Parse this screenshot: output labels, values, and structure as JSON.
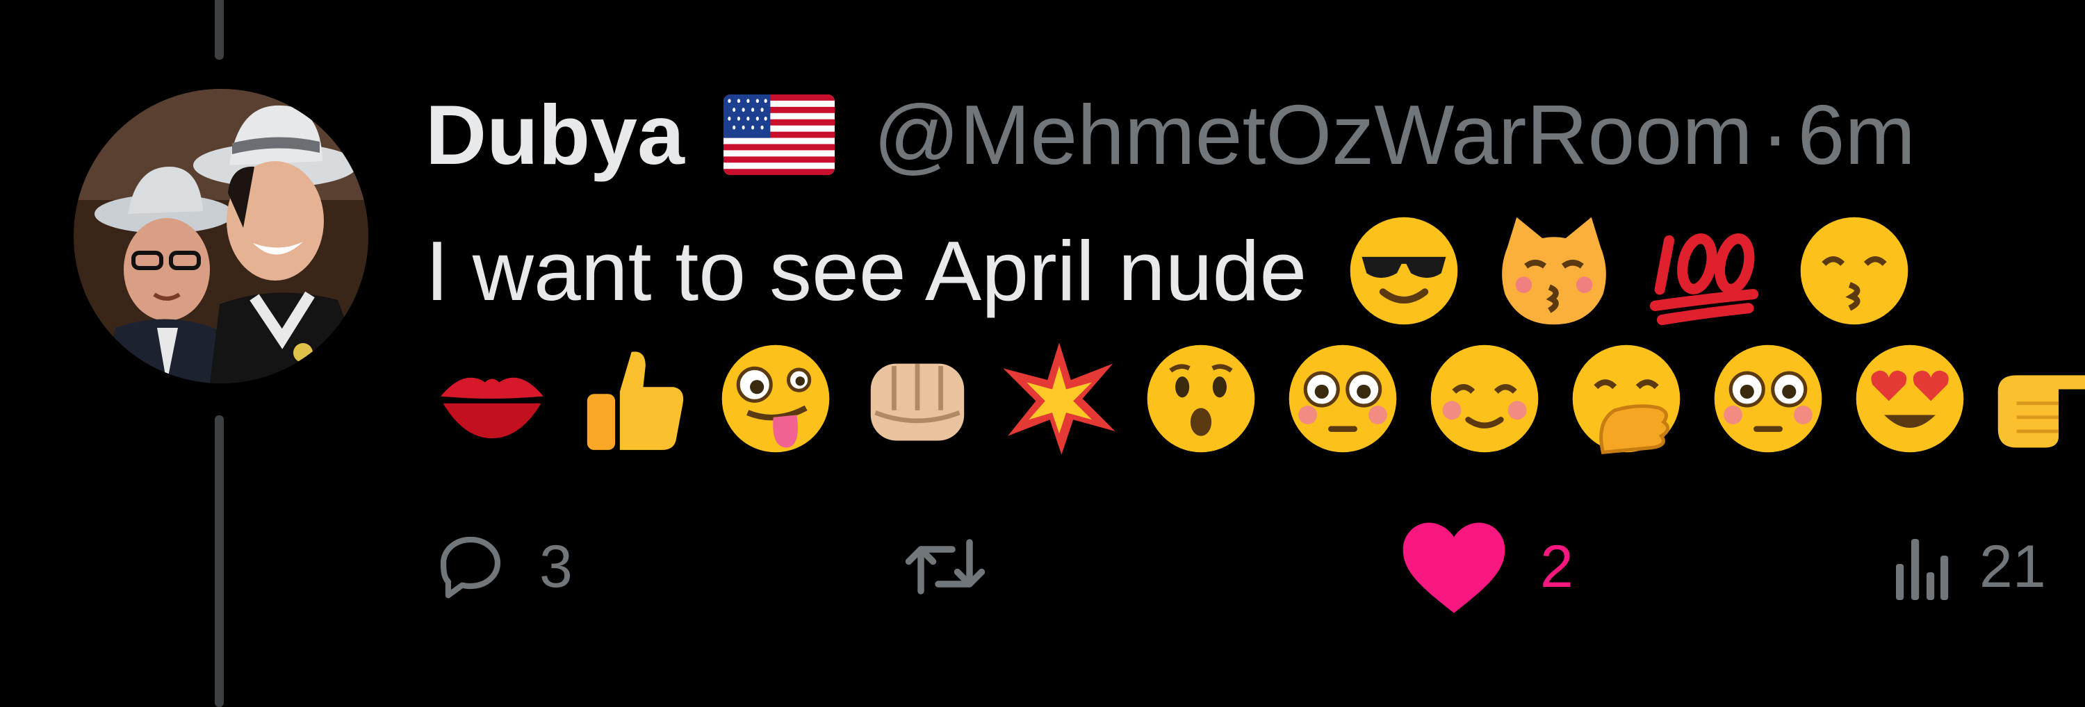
{
  "colors": {
    "background": "#000000",
    "text_primary": "#e7e9ea",
    "text_secondary": "#71767b",
    "like_active": "#f91880",
    "thread_line": "#3e4144"
  },
  "tweet": {
    "display_name": "Dubya",
    "name_flag_icon": "us-flag-icon",
    "handle": "@MehmetOzWarRoom",
    "separator": "·",
    "time": "6m",
    "text": "I want to see April nude",
    "inline_emojis": [
      "smiling-face-with-sunglasses",
      "kissing-cat-face",
      "hundred-points",
      "kissing-face-with-smiling-eyes"
    ],
    "emoji_line": [
      "kiss-mark",
      "thumbs-up",
      "zany-face",
      "oncoming-fist-light-skin",
      "collision",
      "hushed-face",
      "flushed-face",
      "smiling-face",
      "face-with-hand-over-mouth",
      "flushed-face",
      "smiling-face-with-heart-eyes",
      "backhand-index-pointing-right"
    ]
  },
  "actions": {
    "reply": {
      "icon": "reply-bubble-icon",
      "count": "3"
    },
    "retweet": {
      "icon": "retweet-icon",
      "count": ""
    },
    "like": {
      "icon": "heart-icon",
      "count": "2",
      "liked": true
    },
    "views": {
      "icon": "views-bar-chart-icon",
      "count": "21"
    }
  }
}
